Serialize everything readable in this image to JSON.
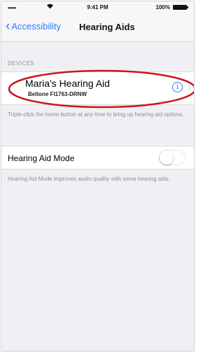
{
  "status_bar": {
    "signal": "•••••",
    "time": "9:41 PM",
    "battery": "100%"
  },
  "nav": {
    "back_label": "Accessibility",
    "title": "Hearing Aids"
  },
  "devices": {
    "header": "DEVICES",
    "items": [
      {
        "name": "Maria's Hearing Aid",
        "model": "Beltone FI1763-DRNW"
      }
    ],
    "footer": "Triple-click the home button at any time to bring up hearing aid options."
  },
  "hearing_aid_mode": {
    "label": "Hearing Aid Mode",
    "enabled": false,
    "footer": "Hearing Aid Mode improves audio quality with some hearing aids."
  },
  "colors": {
    "accent": "#2f7cf6",
    "highlight_oval": "#c8181f",
    "background": "#efeff4"
  },
  "icons": {
    "back": "chevron-left-icon",
    "info": "info-icon",
    "row": "chevron-right-icon"
  }
}
